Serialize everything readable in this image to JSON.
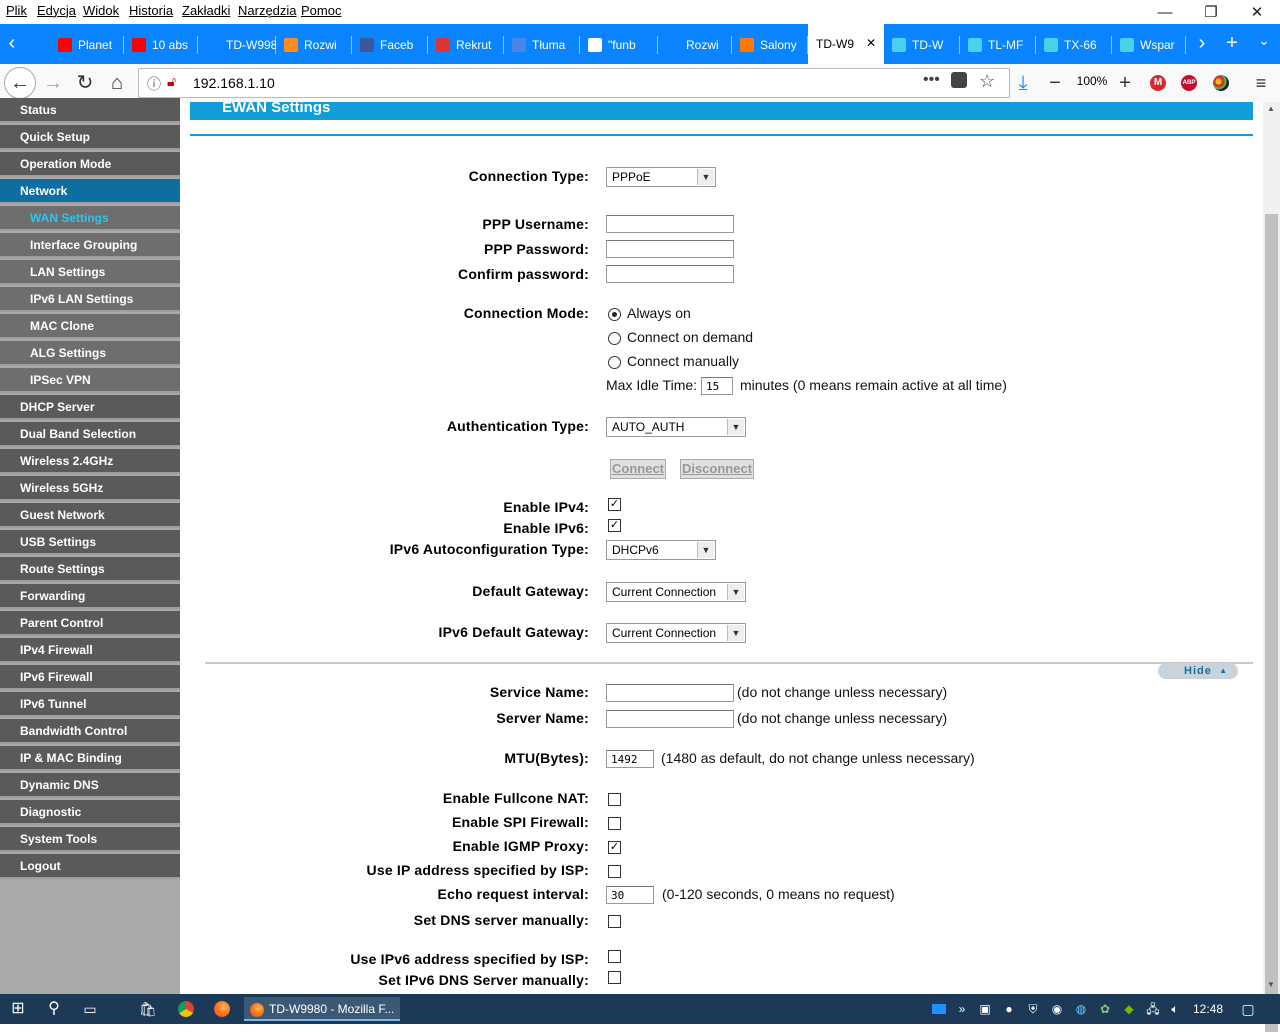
{
  "menu": [
    "Plik",
    "Edycja",
    "Widok",
    "Historia",
    "Zakładki",
    "Narzędzia",
    "Pomoc"
  ],
  "tabs": [
    {
      "label": "Planet",
      "color": "#ff0000",
      "icon": "youtube-icon"
    },
    {
      "label": "10 abs",
      "color": "#ff0000",
      "icon": "youtube-icon"
    },
    {
      "label": "TD-W998",
      "color": "#0a84ff",
      "icon": ""
    },
    {
      "label": "Rozwi",
      "color": "#ff8c1a",
      "icon": "forum-icon"
    },
    {
      "label": "Faceb",
      "color": "#3b5998",
      "icon": "facebook-icon"
    },
    {
      "label": "Rekrut",
      "color": "#d33",
      "icon": "shield-icon"
    },
    {
      "label": "Tłuma",
      "color": "#4a86e8",
      "icon": "translate-icon"
    },
    {
      "label": "\"funb",
      "color": "#ffffff",
      "icon": "google-icon"
    },
    {
      "label": "Rozwi",
      "color": "#0a84ff",
      "icon": ""
    },
    {
      "label": "Salony",
      "color": "#ff7900",
      "icon": "orange-icon"
    },
    {
      "label": "TD-W9",
      "color": "#ffffff",
      "icon": "",
      "active": true
    },
    {
      "label": "TD-W",
      "color": "#4ad0e8",
      "icon": "tplink-icon"
    },
    {
      "label": "TL-MF",
      "color": "#4ad0e8",
      "icon": "tplink-icon"
    },
    {
      "label": "TX-66",
      "color": "#4ad0e8",
      "icon": "tplink-icon"
    },
    {
      "label": "Wspar",
      "color": "#4ad0e8",
      "icon": "tplink-icon"
    }
  ],
  "url": "192.168.1.10",
  "zoom": "100%",
  "sidebar": [
    {
      "label": "Status"
    },
    {
      "label": "Quick Setup"
    },
    {
      "label": "Operation Mode"
    },
    {
      "label": "Network",
      "active": true
    },
    {
      "label": "WAN Settings",
      "sub": true,
      "current": true
    },
    {
      "label": "Interface Grouping",
      "sub": true
    },
    {
      "label": "LAN Settings",
      "sub": true
    },
    {
      "label": "IPv6 LAN Settings",
      "sub": true
    },
    {
      "label": "MAC Clone",
      "sub": true
    },
    {
      "label": "ALG Settings",
      "sub": true
    },
    {
      "label": "IPSec VPN",
      "sub": true
    },
    {
      "label": "DHCP Server"
    },
    {
      "label": "Dual Band Selection"
    },
    {
      "label": "Wireless 2.4GHz"
    },
    {
      "label": "Wireless 5GHz"
    },
    {
      "label": "Guest Network"
    },
    {
      "label": "USB Settings"
    },
    {
      "label": "Route Settings"
    },
    {
      "label": "Forwarding"
    },
    {
      "label": "Parent Control"
    },
    {
      "label": "IPv4 Firewall"
    },
    {
      "label": "IPv6 Firewall"
    },
    {
      "label": "IPv6 Tunnel"
    },
    {
      "label": "Bandwidth Control"
    },
    {
      "label": "IP & MAC Binding"
    },
    {
      "label": "Dynamic DNS"
    },
    {
      "label": "Diagnostic"
    },
    {
      "label": "System Tools"
    },
    {
      "label": "Logout"
    }
  ],
  "page": {
    "title": "EWAN Settings",
    "connection_type_label": "Connection Type:",
    "connection_type_value": "PPPoE",
    "ppp_username_label": "PPP Username:",
    "ppp_password_label": "PPP Password:",
    "confirm_password_label": "Confirm password:",
    "connection_mode_label": "Connection Mode:",
    "mode_always_on": "Always on",
    "mode_on_demand": "Connect on demand",
    "mode_manually": "Connect manually",
    "max_idle_label": "Max Idle Time:",
    "max_idle_value": "15",
    "max_idle_note": "minutes (0 means remain active at all time)",
    "auth_type_label": "Authentication Type:",
    "auth_type_value": "AUTO_AUTH",
    "connect_button": "Connect",
    "disconnect_button": "Disconnect",
    "enable_ipv4_label": "Enable IPv4:",
    "enable_ipv6_label": "Enable IPv6:",
    "ipv6_autoconf_label": "IPv6 Autoconfiguration Type:",
    "ipv6_autoconf_value": "DHCPv6",
    "default_gateway_label": "Default Gateway:",
    "default_gateway_value": "Current Connection",
    "ipv6_default_gateway_label": "IPv6 Default Gateway:",
    "ipv6_default_gateway_value": "Current Connection",
    "hide_button": "Hide",
    "service_name_label": "Service Name:",
    "server_name_label": "Server Name:",
    "do_not_change_note": "(do not change unless necessary)",
    "mtu_label": "MTU(Bytes):",
    "mtu_value": "1492",
    "mtu_note": "(1480 as default, do not change unless necessary)",
    "fullcone_label": "Enable Fullcone NAT:",
    "spi_label": "Enable SPI Firewall:",
    "igmp_label": "Enable IGMP Proxy:",
    "use_ip_isp_label": "Use IP address specified by ISP:",
    "echo_label": "Echo request interval:",
    "echo_value": "30",
    "echo_note": "(0-120 seconds, 0 means no request)",
    "set_dns_label": "Set DNS server manually:",
    "use_ipv6_isp_label": "Use IPv6 address specified by ISP:",
    "set_ipv6_dns_label": "Set IPv6 DNS Server manually:"
  },
  "taskbar": {
    "active_window": "TD-W9980 - Mozilla F...",
    "clock": "12:48"
  },
  "colors": {
    "tabbar": "#0a84ff",
    "sidebar_active": "#0e6e9f",
    "title_bar": "#0f9ed8",
    "taskbar": "#1c3a57"
  }
}
